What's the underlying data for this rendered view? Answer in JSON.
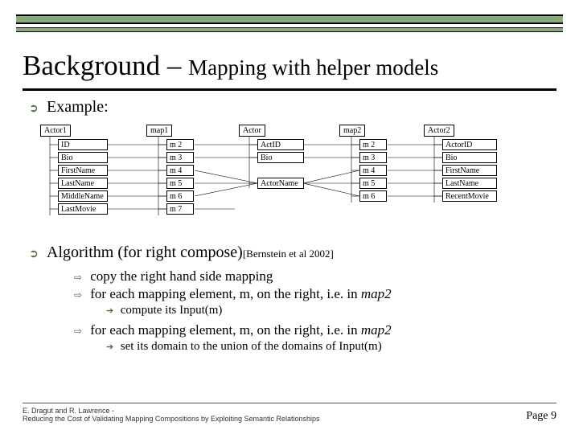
{
  "title": {
    "main": "Background",
    "sep": " – ",
    "sub": "Mapping with helper models"
  },
  "sections": {
    "example_label": "Example:",
    "algorithm_label": "Algorithm (for right compose)",
    "algorithm_cite": "[Bernstein et al 2002]"
  },
  "diagram": {
    "actor1": {
      "header": "Actor1",
      "fields": [
        "ID",
        "Bio",
        "FirstName",
        "LastName",
        "MiddleName",
        "LastMovie"
      ]
    },
    "map1": {
      "header": "map1",
      "items": [
        "m 2",
        "m 3",
        "m 4",
        "m 5",
        "m 6",
        "m 7"
      ]
    },
    "actor": {
      "header": "Actor",
      "fields": [
        "ActID",
        "Bio",
        "ActorName"
      ]
    },
    "map2": {
      "header": "map2",
      "items": [
        "m 2",
        "m 3",
        "m 4",
        "m 5",
        "m 6"
      ]
    },
    "actor2": {
      "header": "Actor2",
      "fields": [
        "ActorID",
        "Bio",
        "FirstName",
        "LastName",
        "RecentMovie"
      ]
    }
  },
  "algorithm_steps": {
    "step1": "copy the right hand side mapping",
    "step2_prefix": "for each mapping element, m, on the right, i.e. in ",
    "step2_map": "map2",
    "step2_sub": "compute its Input(m)",
    "step3_prefix": "for each mapping element, m, on the right, i.e. in ",
    "step3_map": "map2",
    "step3_sub": "set its domain to the union of the domains of Input(m)"
  },
  "footer": {
    "authors": "E. Dragut and R. Lawrence -",
    "paper": "Reducing the Cost of Validating Mapping Compositions by Exploiting Semantic Relationships",
    "page_label": "Page",
    "page_num": "9"
  }
}
